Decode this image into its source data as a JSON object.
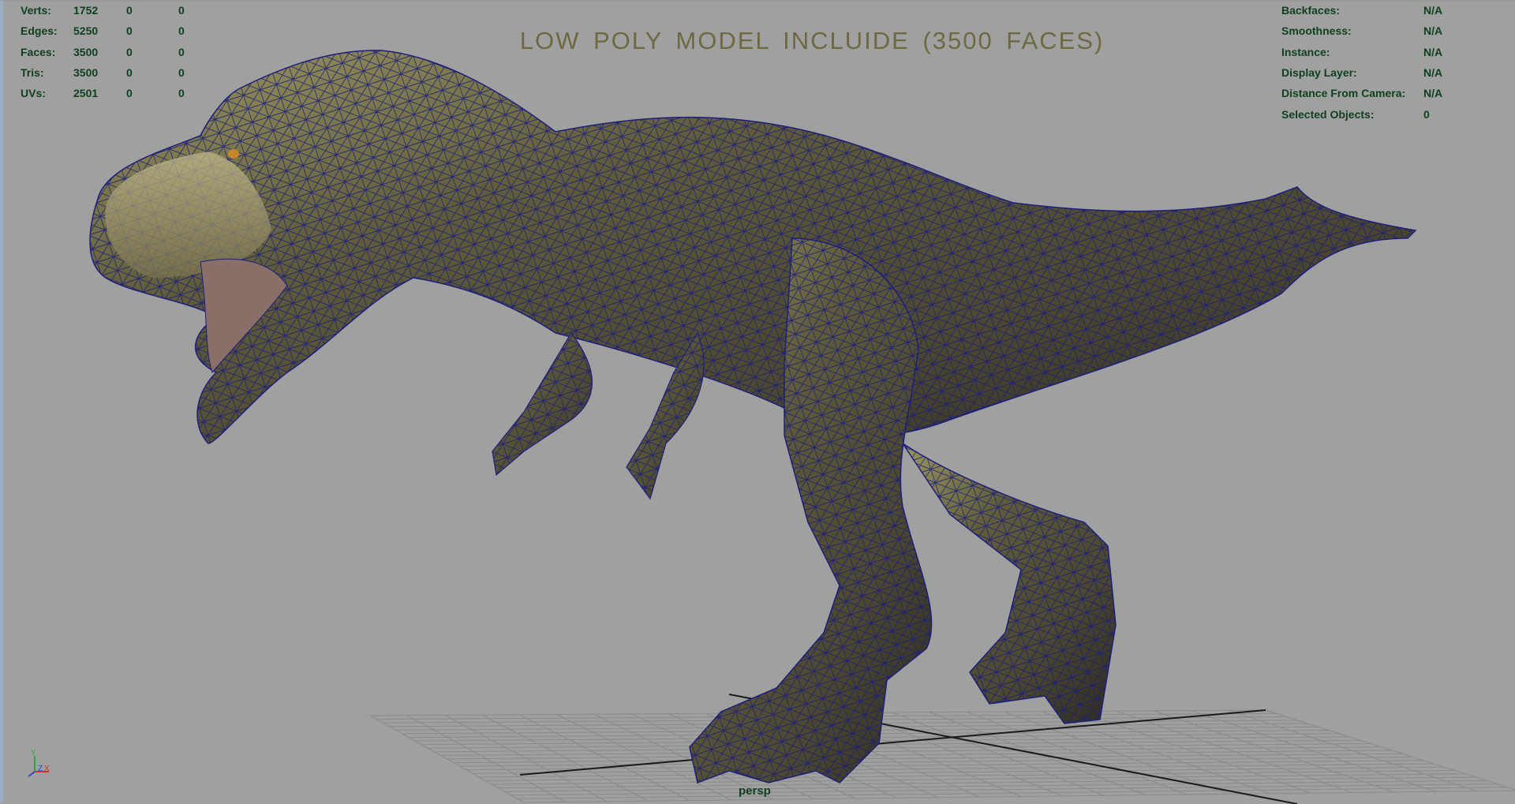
{
  "viewport": {
    "title": "LOW POLY MODEL INCLUIDE (3500 FACES)",
    "camera": "persp",
    "background_color": "#a0a0a0",
    "hud_text_color": "#0e3f1e",
    "wireframe_color": "#1c1e7a"
  },
  "poly_count": {
    "rows": [
      {
        "label": "Verts:",
        "object": "1752",
        "selected": "0",
        "component": "0"
      },
      {
        "label": "Edges:",
        "object": "5250",
        "selected": "0",
        "component": "0"
      },
      {
        "label": "Faces:",
        "object": "3500",
        "selected": "0",
        "component": "0"
      },
      {
        "label": "Tris:",
        "object": "3500",
        "selected": "0",
        "component": "0"
      },
      {
        "label": "UVs:",
        "object": "2501",
        "selected": "0",
        "component": "0"
      }
    ]
  },
  "object_details": {
    "rows": [
      {
        "label": "Backfaces:",
        "value": "N/A"
      },
      {
        "label": "Smoothness:",
        "value": "N/A"
      },
      {
        "label": "Instance:",
        "value": "N/A"
      },
      {
        "label": "Display Layer:",
        "value": "N/A"
      },
      {
        "label": "Distance From Camera:",
        "value": "N/A"
      },
      {
        "label": "Selected Objects:",
        "value": "0"
      }
    ]
  },
  "axis": {
    "y": "Y",
    "z": "Z",
    "x": "X"
  },
  "model": {
    "subject": "t-rex-wireframe-model"
  }
}
